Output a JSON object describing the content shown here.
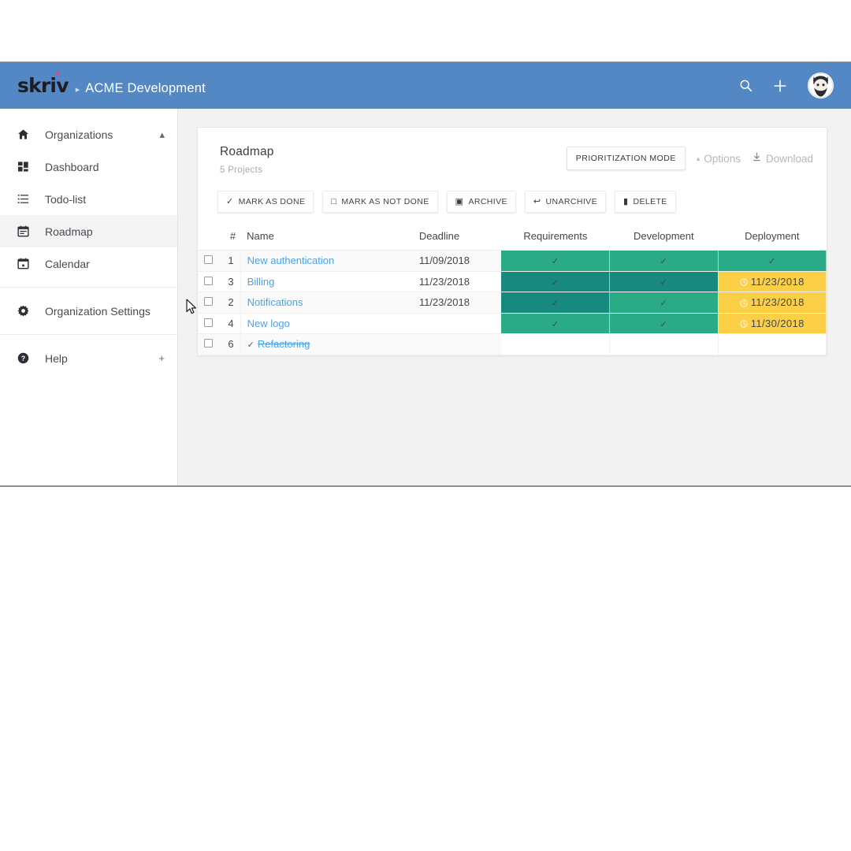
{
  "header": {
    "logo_text": "skriv",
    "separator": "▸",
    "org_name": "ACME Development",
    "search_icon": "search-icon",
    "add_icon": "plus-icon",
    "avatar_icon": "user-avatar"
  },
  "sidebar": {
    "items": [
      {
        "label": "Organizations",
        "icon": "home-icon",
        "right": "▴",
        "active": false
      },
      {
        "label": "Dashboard",
        "icon": "grid-icon",
        "right": "",
        "active": false
      },
      {
        "label": "Todo-list",
        "icon": "list-icon",
        "right": "",
        "active": false
      },
      {
        "label": "Roadmap",
        "icon": "calendar-roadmap-icon",
        "right": "",
        "active": true
      },
      {
        "label": "Calendar",
        "icon": "calendar-icon",
        "right": "",
        "active": false
      },
      {
        "label": "Organization Settings",
        "icon": "gear-icon",
        "right": "",
        "active": false
      },
      {
        "label": "Help",
        "icon": "help-icon",
        "right": "+",
        "active": false
      }
    ]
  },
  "card": {
    "title": "Roadmap",
    "subtitle": "5 Projects",
    "prioritization_button": "PRIORITIZATION MODE",
    "options_label": "Options",
    "options_caret": "▴",
    "download_label": "Download"
  },
  "toolbar": {
    "buttons": [
      {
        "label": "MARK AS DONE",
        "icon": "check-icon",
        "glyph": "✓"
      },
      {
        "label": "MARK AS NOT DONE",
        "icon": "empty-square-icon",
        "glyph": "□"
      },
      {
        "label": "ARCHIVE",
        "icon": "archive-icon",
        "glyph": "▣"
      },
      {
        "label": "UNARCHIVE",
        "icon": "unarchive-arrow-icon",
        "glyph": "↩"
      },
      {
        "label": "DELETE",
        "icon": "trash-icon",
        "glyph": "▮"
      }
    ]
  },
  "table": {
    "columns": [
      "#",
      "Name",
      "Deadline",
      "Requirements",
      "Development",
      "Deployment"
    ],
    "rows": [
      {
        "num": "1",
        "name": "New authentication",
        "deadline": "11/09/2018",
        "done": false,
        "requirements": {
          "state": "green",
          "text": "✓"
        },
        "development": {
          "state": "green",
          "text": "✓"
        },
        "deployment": {
          "state": "green",
          "text": "✓"
        }
      },
      {
        "num": "3",
        "name": "Billing",
        "deadline": "11/23/2018",
        "done": false,
        "requirements": {
          "state": "teal",
          "text": "✓"
        },
        "development": {
          "state": "teal",
          "text": "✓"
        },
        "deployment": {
          "state": "yellow",
          "text": "11/23/2018"
        }
      },
      {
        "num": "2",
        "name": "Notifications",
        "deadline": "11/23/2018",
        "done": false,
        "requirements": {
          "state": "teal",
          "text": "✓"
        },
        "development": {
          "state": "green",
          "text": "✓"
        },
        "deployment": {
          "state": "yellow",
          "text": "11/23/2018"
        }
      },
      {
        "num": "4",
        "name": "New logo",
        "deadline": "",
        "done": false,
        "requirements": {
          "state": "green",
          "text": "✓"
        },
        "development": {
          "state": "green",
          "text": "✓"
        },
        "deployment": {
          "state": "yellow",
          "text": "11/30/2018"
        }
      },
      {
        "num": "6",
        "name": "Refactoring",
        "deadline": "",
        "done": true,
        "requirements": {
          "state": "empty",
          "text": ""
        },
        "development": {
          "state": "empty",
          "text": ""
        },
        "deployment": {
          "state": "empty",
          "text": ""
        }
      }
    ]
  },
  "colors": {
    "header_blue": "#5488c4",
    "status_green": "#2bab85",
    "status_teal": "#17897f",
    "status_yellow": "#fbd046",
    "link_blue": "#4ba3e8",
    "deadline_green": "#5cb48a",
    "logo_dot_pink": "#e8447e"
  }
}
